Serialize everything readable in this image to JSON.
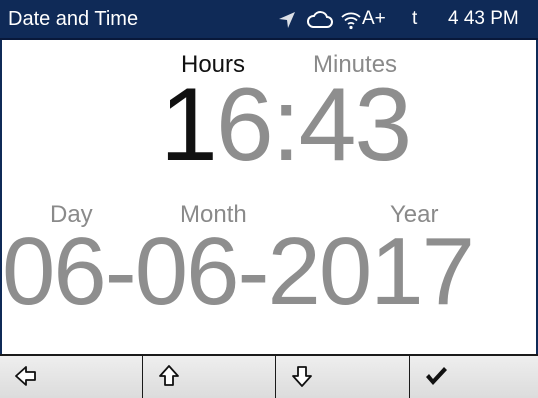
{
  "status_bar": {
    "title": "Date and Time",
    "network_indicator": "A+",
    "carrier_indicator": "t",
    "clock": "4 43 PM",
    "icons": [
      "location-arrow-icon",
      "cloud-icon",
      "wifi-icon"
    ],
    "background_color": "#0f2a57"
  },
  "time_editor": {
    "hours_label": "Hours",
    "minutes_label": "Minutes",
    "hours_first_digit": "1",
    "hours_second_digit": "6",
    "separator": ":",
    "minutes": "43",
    "active_field": "hours"
  },
  "date_editor": {
    "day_label": "Day",
    "month_label": "Month",
    "year_label": "Year",
    "day": "06",
    "separator_1": "-",
    "month": "06",
    "separator_2": "-",
    "year": "2017"
  },
  "softkeys": [
    {
      "icon": "arrow-left-icon"
    },
    {
      "icon": "arrow-up-icon"
    },
    {
      "icon": "arrow-down-icon"
    },
    {
      "icon": "checkmark-icon"
    }
  ],
  "colors": {
    "active_text": "#111111",
    "inactive_text": "#8e8e8e",
    "softkey_bg": "#dcdcdc"
  }
}
